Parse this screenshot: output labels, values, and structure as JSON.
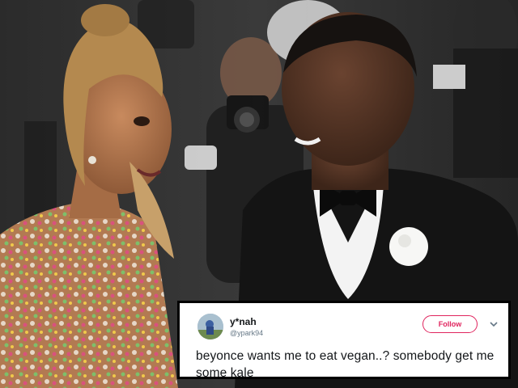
{
  "tweet": {
    "display_name": "y*nah",
    "handle": "@ypark94",
    "follow_label": "Follow",
    "text": "beyonce wants me to eat vegan..? somebody get me some kale",
    "avatar_icon": "user-avatar-icon",
    "menu_icon": "chevron-down-icon",
    "accent_color": "#e0245e"
  }
}
